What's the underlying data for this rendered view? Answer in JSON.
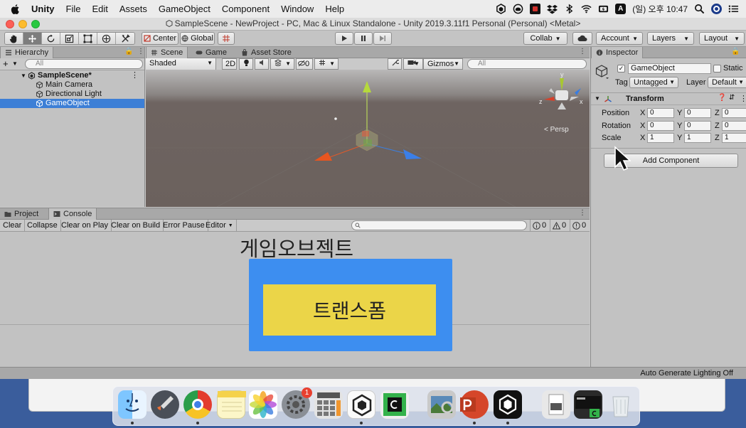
{
  "menubar": {
    "app_name": "Unity",
    "items": [
      "File",
      "Edit",
      "Assets",
      "GameObject",
      "Component",
      "Window",
      "Help"
    ],
    "clock": "(일) 오후 10:47",
    "input_source": "A"
  },
  "window": {
    "title": "SampleScene - NewProject - PC, Mac & Linux Standalone - Unity 2019.3.11f1 Personal (Personal) <Metal>"
  },
  "toolbar": {
    "pivot": "Center",
    "space": "Global",
    "collab": "Collab",
    "account": "Account",
    "layers": "Layers",
    "layout": "Layout"
  },
  "hierarchy": {
    "tab": "Hierarchy",
    "search_placeholder": "All",
    "scene": "SampleScene*",
    "items": [
      {
        "label": "Main Camera"
      },
      {
        "label": "Directional Light"
      },
      {
        "label": "GameObject"
      }
    ]
  },
  "scene": {
    "tabs": [
      "Scene",
      "Game",
      "Asset Store"
    ],
    "shading": "Shaded",
    "mode_2d": "2D",
    "hidden_count": "0",
    "gizmos": "Gizmos",
    "search_placeholder": "All",
    "persp": "< Persp",
    "axis_labels": {
      "x": "x",
      "y": "y",
      "z": "z"
    }
  },
  "console": {
    "tabs": [
      "Project",
      "Console"
    ],
    "buttons": [
      "Clear",
      "Collapse",
      "Clear on Play",
      "Clear on Build",
      "Error Pause"
    ],
    "editor": "Editor",
    "counts": {
      "info": "0",
      "warn": "0",
      "error": "0"
    }
  },
  "inspector": {
    "tab": "Inspector",
    "object_name": "GameObject",
    "static_label": "Static",
    "tag_label": "Tag",
    "tag_value": "Untagged",
    "layer_label": "Layer",
    "layer_value": "Default",
    "component_title": "Transform",
    "rows": [
      {
        "label": "Position",
        "x": "0",
        "y": "0",
        "z": "0"
      },
      {
        "label": "Rotation",
        "x": "0",
        "y": "0",
        "z": "0"
      },
      {
        "label": "Scale",
        "x": "1",
        "y": "1",
        "z": "1"
      }
    ],
    "axis": {
      "x": "X",
      "y": "Y",
      "z": "Z"
    },
    "add_component": "Add Component"
  },
  "status": {
    "lighting": "Auto Generate Lighting Off"
  },
  "overlay": {
    "title": "게임오브젝트",
    "box_label": "트랜스폼"
  },
  "dock": {
    "badge": "1"
  },
  "colors": {
    "selection": "#3d7fd6",
    "overlay_blue": "#3d8ef0",
    "overlay_yellow": "#ebd548"
  }
}
